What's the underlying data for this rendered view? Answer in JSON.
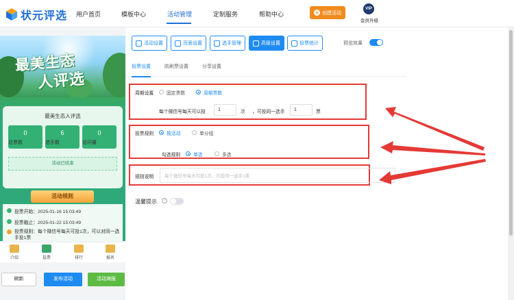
{
  "app": {
    "logo_text": "状元评选"
  },
  "nav": {
    "items": [
      "用户首页",
      "模板中心",
      "活动管理",
      "定制服务",
      "帮助中心"
    ],
    "create_button": "创建活动",
    "vip_badge": "VIP",
    "vip_label": "会员升级"
  },
  "preview": {
    "hero_line1": "最美生态",
    "hero_line2": "人评选",
    "card_title": "最美生态人评选",
    "stats": [
      {
        "value": "0",
        "label": "总票数"
      },
      {
        "value": "6",
        "label": "选手数"
      },
      {
        "value": "0",
        "label": "访问量"
      }
    ],
    "status": "活动已结束",
    "rules_title": "活动规则",
    "rules": [
      "投票开始：2025-01-16 15:03:49",
      "投票截止：2025-01-22 15:03:49",
      "投票规则：每个微信号每天可投1次，可以对同一选手投1票"
    ],
    "tabbar": [
      "介绍",
      "投票",
      "排行",
      "报名"
    ],
    "buttons": {
      "refresh": "刷新",
      "publish": "发布活动",
      "poster": "活动海报"
    }
  },
  "toolbar": {
    "buttons": [
      "活动设置",
      "页面设置",
      "选手管理",
      "高级设置",
      "投票统计"
    ],
    "active_index": 3,
    "preview_toggle_label": "预览效果",
    "preview_toggle_on": true
  },
  "subtabs": {
    "items": [
      "投票设置",
      "防刷票设置",
      "分享设置"
    ],
    "active_index": 0
  },
  "settings": {
    "period": {
      "label": "周期设置",
      "options": [
        "固定票数",
        "周期票数"
      ],
      "selected": "周期票数",
      "sentence_a": "每个微信号每天可以投",
      "value_a": "1",
      "unit_a": "次",
      "sentence_b": "，可投同一选手",
      "value_b": "1",
      "unit_b": "票"
    },
    "rule": {
      "label": "投票规则",
      "options": [
        "按活动",
        "单分组"
      ],
      "selected": "按活动",
      "check_label": "勾选规则",
      "check_options": [
        "单选",
        "多选"
      ],
      "check_selected": "单选"
    },
    "description": {
      "label": "规则说明",
      "placeholder": "每个微信号每天可投1次，可投同一选手1票"
    },
    "tip": {
      "label": "温馨提示",
      "help": "?",
      "enabled": false
    }
  },
  "colors": {
    "accent": "#1e8bf0",
    "annotation": "#e53935",
    "brand": "#1f6fd6",
    "create": "#f28b1e"
  }
}
